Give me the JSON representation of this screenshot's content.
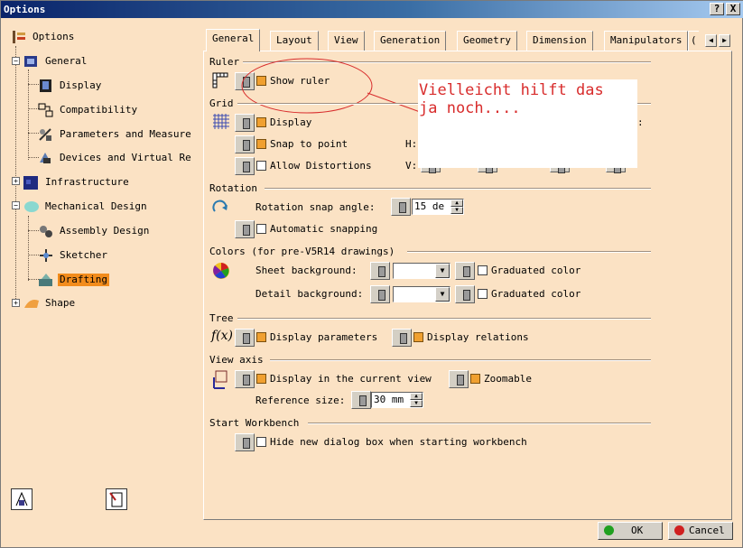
{
  "window": {
    "title": "Options",
    "help": "?",
    "close": "X"
  },
  "tree": [
    {
      "label": "Options",
      "icon": "options-icon"
    },
    {
      "label": "General",
      "icon": "general-icon"
    },
    {
      "label": "Display",
      "icon": "display-icon"
    },
    {
      "label": "Compatibility",
      "icon": "compatibility-icon"
    },
    {
      "label": "Parameters and Measure",
      "icon": "parameters-icon"
    },
    {
      "label": "Devices and Virtual Re",
      "icon": "devices-icon"
    },
    {
      "label": "Infrastructure",
      "icon": "infrastructure-icon"
    },
    {
      "label": "Mechanical Design",
      "icon": "mechanical-design-icon"
    },
    {
      "label": "Assembly Design",
      "icon": "assembly-design-icon"
    },
    {
      "label": "Sketcher",
      "icon": "sketcher-icon"
    },
    {
      "label": "Drafting",
      "icon": "drafting-icon",
      "selected": true
    },
    {
      "label": "Shape",
      "icon": "shape-icon"
    }
  ],
  "tabs": [
    "General",
    "Layout",
    "View",
    "Generation",
    "Geometry",
    "Dimension",
    "Manipulators"
  ],
  "active_tab": "General",
  "tab_overflow": "(",
  "sections": {
    "ruler": {
      "title": "Ruler",
      "show_ruler": "Show ruler",
      "show_ruler_checked": true
    },
    "grid": {
      "title": "Grid",
      "display": "Display",
      "display_checked": true,
      "snap": "Snap to point",
      "snap_checked": true,
      "allow": "Allow Distortions",
      "allow_checked": false,
      "h_label": "H:",
      "v_label": "V:",
      "extra_colon": ":"
    },
    "rotation": {
      "title": "Rotation",
      "snap_angle_label": "Rotation snap angle:",
      "snap_angle_value": "15 de",
      "auto_snap": "Automatic snapping",
      "auto_snap_checked": false
    },
    "colors": {
      "title": "Colors (for pre-V5R14 drawings)",
      "sheet_bg": "Sheet background:",
      "detail_bg": "Detail background:",
      "graduated": "Graduated color",
      "sheet_graduated_checked": false,
      "detail_graduated_checked": false
    },
    "tree": {
      "title": "Tree",
      "display_params": "Display parameters",
      "display_params_checked": true,
      "display_rel": "Display relations",
      "display_rel_checked": true
    },
    "view_axis": {
      "title": "View axis",
      "current_view": "Display in the current view",
      "zoomable": "Zoomable",
      "zoomable_checked": true,
      "ref_size_label": "Reference size:",
      "ref_size_value": "30 mm"
    },
    "start_workbench": {
      "title": "Start Workbench",
      "hide": "Hide new dialog box when starting workbench",
      "hide_checked": false
    }
  },
  "annotation": "Vielleicht hilft das\nja noch....",
  "buttons": {
    "ok": "OK",
    "cancel": "Cancel"
  },
  "colors": {
    "accent": "#f28c1c",
    "panel": "#fbe2c4",
    "annotation": "#d82c2c"
  }
}
